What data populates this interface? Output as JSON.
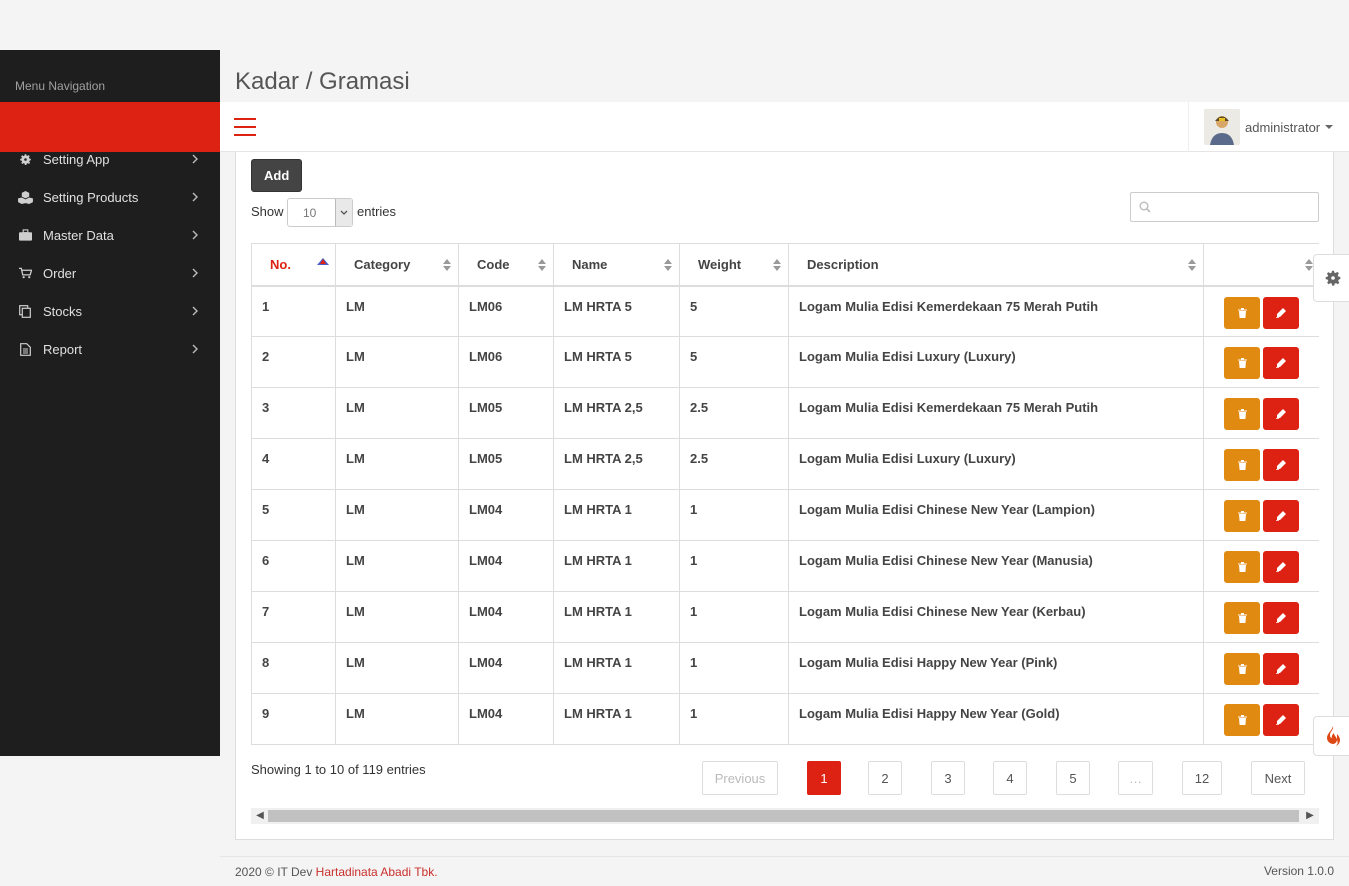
{
  "page": {
    "title": "Kadar / Gramasi"
  },
  "sidebar": {
    "title": "Menu Navigation",
    "items": [
      {
        "label": "Setting App",
        "icon": "gear-icon"
      },
      {
        "label": "Setting Products",
        "icon": "cubes-icon"
      },
      {
        "label": "Master Data",
        "icon": "briefcase-icon"
      },
      {
        "label": "Order",
        "icon": "cart-icon"
      },
      {
        "label": "Stocks",
        "icon": "copy-icon"
      },
      {
        "label": "Report",
        "icon": "file-icon"
      }
    ]
  },
  "header": {
    "user": "administrator"
  },
  "toolbar": {
    "add_label": "Add",
    "show_label": "Show",
    "entries_value": "10",
    "entries_label": "entries",
    "search_placeholder": ""
  },
  "table": {
    "columns": [
      "No.",
      "Category",
      "Code",
      "Name",
      "Weight",
      "Description",
      ""
    ],
    "sorted_column": "No.",
    "rows": [
      [
        "1",
        "LM",
        "LM06",
        "LM HRTA 5",
        "5",
        "Logam Mulia Edisi Kemerdekaan 75 Merah Putih"
      ],
      [
        "2",
        "LM",
        "LM06",
        "LM HRTA 5",
        "5",
        "Logam Mulia Edisi Luxury (Luxury)"
      ],
      [
        "3",
        "LM",
        "LM05",
        "LM HRTA 2,5",
        "2.5",
        "Logam Mulia Edisi Kemerdekaan 75 Merah Putih"
      ],
      [
        "4",
        "LM",
        "LM05",
        "LM HRTA 2,5",
        "2.5",
        "Logam Mulia Edisi Luxury (Luxury)"
      ],
      [
        "5",
        "LM",
        "LM04",
        "LM HRTA 1",
        "1",
        "Logam Mulia Edisi Chinese New Year (Lampion)"
      ],
      [
        "6",
        "LM",
        "LM04",
        "LM HRTA 1",
        "1",
        "Logam Mulia Edisi Chinese New Year (Manusia)"
      ],
      [
        "7",
        "LM",
        "LM04",
        "LM HRTA 1",
        "1",
        "Logam Mulia Edisi Chinese New Year (Kerbau)"
      ],
      [
        "8",
        "LM",
        "LM04",
        "LM HRTA 1",
        "1",
        "Logam Mulia Edisi Happy New Year (Pink)"
      ],
      [
        "9",
        "LM",
        "LM04",
        "LM HRTA 1",
        "1",
        "Logam Mulia Edisi Happy New Year (Gold)"
      ]
    ],
    "action_icons": [
      "trash-icon",
      "pencil-icon"
    ]
  },
  "pagination": {
    "info": "Showing 1 to 10 of 119 entries",
    "previous": "Previous",
    "pages": [
      "1",
      "2",
      "3",
      "4",
      "5",
      "…",
      "12"
    ],
    "current": "1",
    "next": "Next"
  },
  "footer": {
    "copyright": "2020 © IT Dev ",
    "company": "Hartadinata Abadi Tbk.",
    "version": "Version 1.0.0"
  },
  "colors": {
    "accent": "#dd2113",
    "warning": "#e08a12",
    "sidebar": "#1e1e1e"
  }
}
